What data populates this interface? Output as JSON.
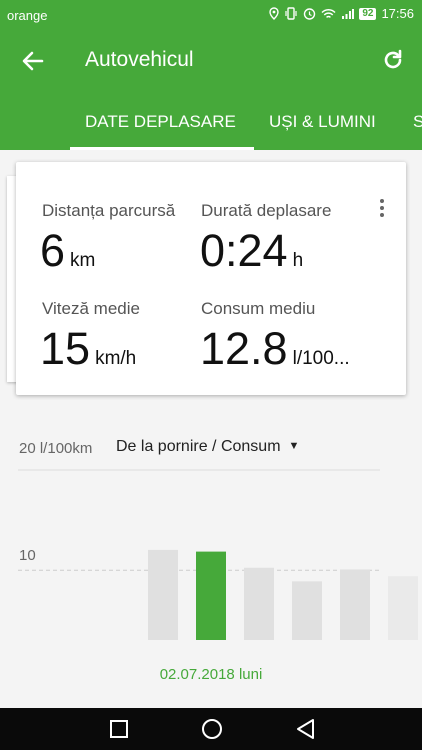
{
  "status": {
    "carrier": "orange",
    "battery": "92",
    "time": "17:56"
  },
  "appbar": {
    "title": "Autovehicul",
    "back_icon": "arrow-left-icon",
    "refresh_icon": "refresh-icon"
  },
  "tabs": [
    {
      "label": "DATE DEPLASARE",
      "selected": true
    },
    {
      "label": "UȘI & LUMINI",
      "selected": false
    },
    {
      "label": "S",
      "selected": false
    }
  ],
  "stats": [
    {
      "label": "Distanța parcursă",
      "value": "6",
      "unit": "km"
    },
    {
      "label": "Durată deplasare",
      "value": "0:24",
      "unit": "h"
    },
    {
      "label": "Viteză medie",
      "value": "15",
      "unit": "km/h"
    },
    {
      "label": "Consum mediu",
      "value": "12.8",
      "unit": "l/100..."
    }
  ],
  "chart_header": {
    "scale_label": "20 l/100km",
    "selector": "De la pornire / Consum"
  },
  "chart_data": {
    "type": "bar",
    "ylim": [
      0,
      20
    ],
    "ytick_label": "10",
    "ytick_value": 10,
    "reference_line": 8.2,
    "values": [
      10.6,
      10.4,
      8.5,
      6.9,
      8.3,
      7.5
    ],
    "highlight_index": 1,
    "highlight_color": "#46a93a",
    "bar_color": "#e0e0e0"
  },
  "date_label": "02.07.2018 luni",
  "colors": {
    "brand": "#46a93a"
  }
}
